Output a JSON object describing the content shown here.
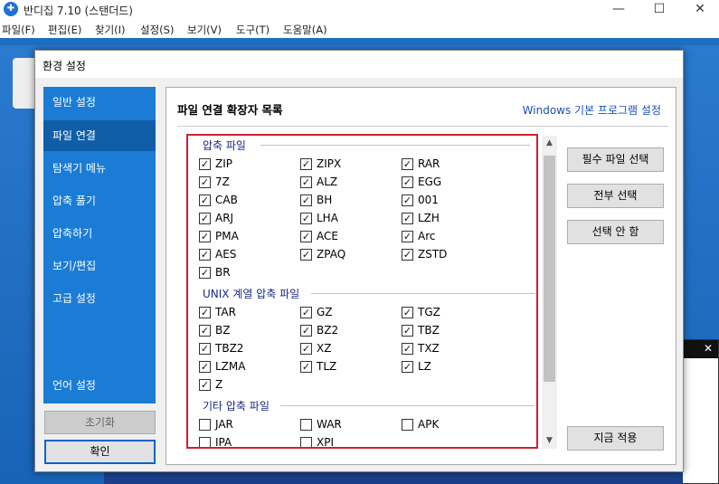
{
  "app": {
    "title": "반디집 7.10 (스탠더드)",
    "icon": "bandizip-icon",
    "window_controls": {
      "minimize": "—",
      "maximize": "☐",
      "close": "✕"
    },
    "menu": [
      "파일(F)",
      "편집(E)",
      "찾기(I)",
      "설정(S)",
      "보기(V)",
      "도구(T)",
      "도움말(A)"
    ],
    "bg_panel_close": "✕"
  },
  "dialog": {
    "title": "환경 설정",
    "nav": [
      "일반 설정",
      "파일 연결",
      "탐색기 메뉴",
      "압축 풀기",
      "압축하기",
      "보기/편집",
      "고급 설정",
      "언어 설정"
    ],
    "active_nav": "파일 연결",
    "reset_label": "초기화",
    "ok_label": "확인",
    "content_title": "파일 연결 확장자 목록",
    "windows_default_link": "Windows 기본 프로그램 설정",
    "buttons": {
      "required": "필수 파일 선택",
      "select_all": "전부 선택",
      "select_none": "선택 안 함",
      "apply_now": "지금 적용"
    },
    "groups": [
      {
        "heading": "압축 파일",
        "items": [
          {
            "label": "ZIP",
            "checked": true
          },
          {
            "label": "ZIPX",
            "checked": true
          },
          {
            "label": "RAR",
            "checked": true
          },
          {
            "label": "7Z",
            "checked": true
          },
          {
            "label": "ALZ",
            "checked": true
          },
          {
            "label": "EGG",
            "checked": true
          },
          {
            "label": "CAB",
            "checked": true
          },
          {
            "label": "BH",
            "checked": true
          },
          {
            "label": "001",
            "checked": true
          },
          {
            "label": "ARJ",
            "checked": true
          },
          {
            "label": "LHA",
            "checked": true
          },
          {
            "label": "LZH",
            "checked": true
          },
          {
            "label": "PMA",
            "checked": true
          },
          {
            "label": "ACE",
            "checked": true
          },
          {
            "label": "Arc",
            "checked": true
          },
          {
            "label": "AES",
            "checked": true
          },
          {
            "label": "ZPAQ",
            "checked": true
          },
          {
            "label": "ZSTD",
            "checked": true
          },
          {
            "label": "BR",
            "checked": true
          }
        ]
      },
      {
        "heading": "UNIX 계열 압축 파일",
        "items": [
          {
            "label": "TAR",
            "checked": true
          },
          {
            "label": "GZ",
            "checked": true
          },
          {
            "label": "TGZ",
            "checked": true
          },
          {
            "label": "BZ",
            "checked": true
          },
          {
            "label": "BZ2",
            "checked": true
          },
          {
            "label": "TBZ",
            "checked": true
          },
          {
            "label": "TBZ2",
            "checked": true
          },
          {
            "label": "XZ",
            "checked": true
          },
          {
            "label": "TXZ",
            "checked": true
          },
          {
            "label": "LZMA",
            "checked": true
          },
          {
            "label": "TLZ",
            "checked": true
          },
          {
            "label": "LZ",
            "checked": true
          },
          {
            "label": "Z",
            "checked": true
          }
        ]
      },
      {
        "heading": "기타 압축 파일",
        "items": [
          {
            "label": "JAR",
            "checked": false
          },
          {
            "label": "WAR",
            "checked": false
          },
          {
            "label": "APK",
            "checked": false
          },
          {
            "label": "IPA",
            "checked": false
          },
          {
            "label": "XPI",
            "checked": false
          }
        ]
      }
    ]
  }
}
